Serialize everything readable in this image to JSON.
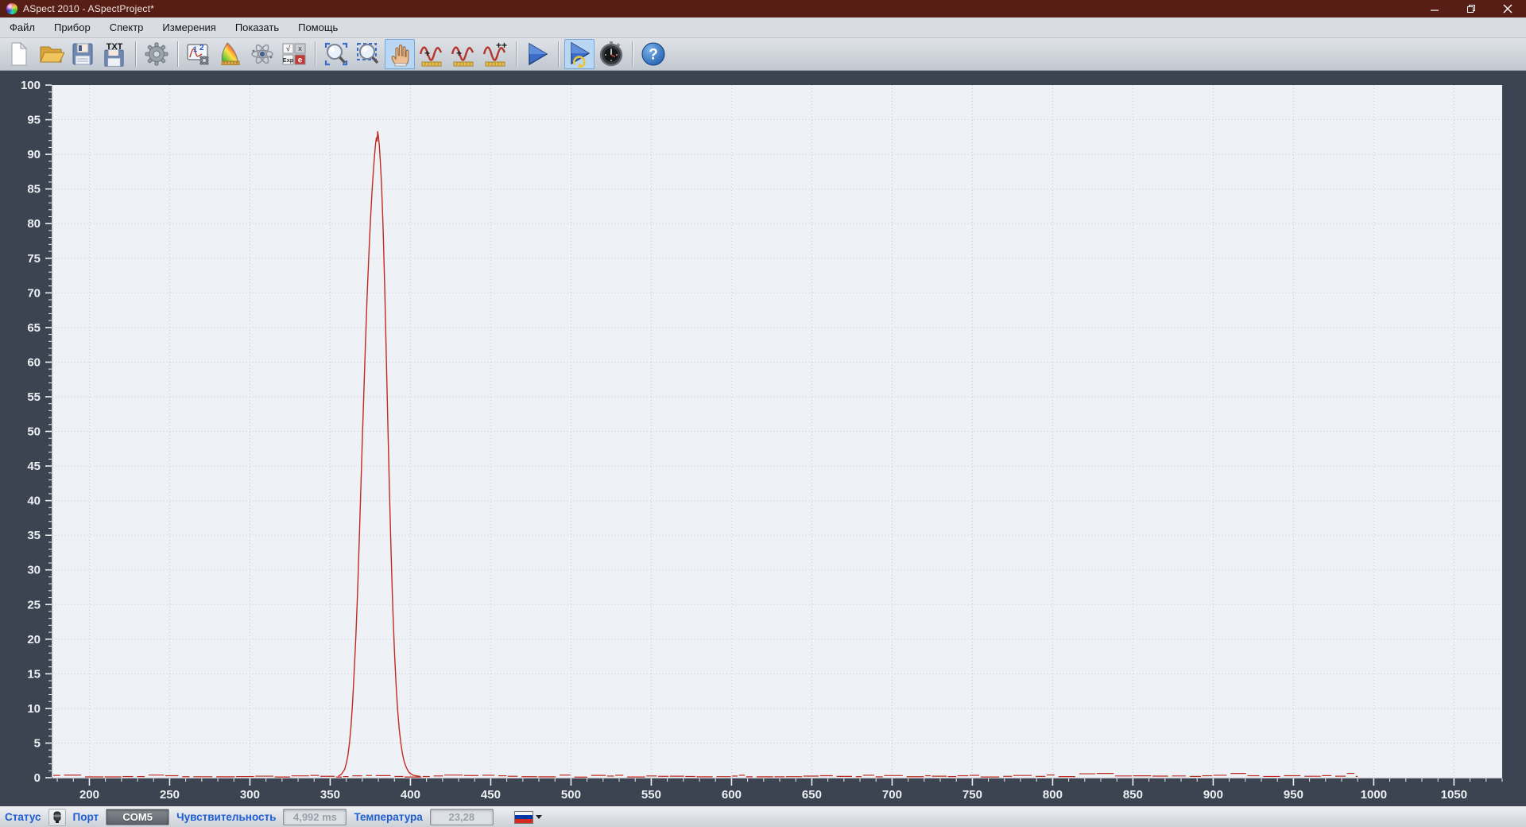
{
  "window": {
    "title": "ASpect 2010 - ASpectProject*",
    "controls": [
      "minimize",
      "restore",
      "close"
    ]
  },
  "menu": {
    "items": [
      "Файл",
      "Прибор",
      "Спектр",
      "Измерения",
      "Показать",
      "Помощь"
    ]
  },
  "toolbar": {
    "groups": [
      {
        "buttons": [
          {
            "name": "new-document",
            "icon": "new-document-icon"
          },
          {
            "name": "open-project",
            "icon": "open-folder-icon"
          },
          {
            "name": "save-project",
            "icon": "save-icon"
          },
          {
            "name": "export-txt",
            "icon": "save-txt-icon",
            "glyph": "TXT"
          }
        ]
      },
      {
        "buttons": [
          {
            "name": "settings",
            "icon": "gear-icon"
          }
        ]
      },
      {
        "buttons": [
          {
            "name": "measurement-setup",
            "icon": "measurement-setup-icon",
            "glyph": "1 2"
          },
          {
            "name": "color-measurement",
            "icon": "color-triangle-icon"
          },
          {
            "name": "atomic-spectra",
            "icon": "atom-icon"
          },
          {
            "name": "math-functions",
            "icon": "math-icon",
            "glyphs": [
              "√",
              "x",
              "Exp",
              "e"
            ]
          }
        ]
      },
      {
        "buttons": [
          {
            "name": "zoom-in",
            "icon": "zoom-in-icon"
          },
          {
            "name": "zoom-out",
            "icon": "zoom-out-icon"
          },
          {
            "name": "pan",
            "icon": "hand-icon",
            "active": true
          },
          {
            "name": "peak-tool-1",
            "icon": "wave-plus-icon",
            "glyph": "+"
          },
          {
            "name": "peak-tool-2",
            "icon": "wave-plus-icon",
            "glyph": "+"
          },
          {
            "name": "peak-tool-3",
            "icon": "wave-plus-icon",
            "glyph": "++"
          }
        ]
      },
      {
        "buttons": [
          {
            "name": "start-measurement",
            "icon": "play-icon"
          }
        ]
      },
      {
        "buttons": [
          {
            "name": "continuous-measurement",
            "icon": "play-repeat-icon",
            "active": true
          },
          {
            "name": "timer",
            "icon": "stopwatch-icon"
          }
        ]
      },
      {
        "buttons": [
          {
            "name": "help",
            "icon": "help-icon",
            "glyph": "?"
          }
        ]
      }
    ]
  },
  "chart_data": {
    "type": "line",
    "title": "",
    "xlabel": "",
    "ylabel": "",
    "grid": "dotted",
    "legend": "none",
    "x_axis": {
      "min": 177,
      "max": 1080,
      "label_min": 200,
      "label_max": 1050,
      "major_step": 50,
      "minor_step": 10
    },
    "y_axis": {
      "min": 0,
      "max": 100,
      "major_step": 5,
      "minor_step": 1
    },
    "series": [
      {
        "name": "emission-spectrum",
        "color": "#bf2b20",
        "peak": {
          "center_nm": 379.5,
          "max_value": 93.3,
          "base_from_nm": 359,
          "base_to_nm": 404
        },
        "points": [
          [
            355,
            0.2
          ],
          [
            357,
            0.5
          ],
          [
            359,
            1.2
          ],
          [
            360,
            2
          ],
          [
            361,
            3.2
          ],
          [
            362,
            5
          ],
          [
            363,
            7.5
          ],
          [
            364,
            11
          ],
          [
            365,
            15.5
          ],
          [
            366,
            20.5
          ],
          [
            367,
            26.5
          ],
          [
            368,
            33.5
          ],
          [
            369,
            41
          ],
          [
            370,
            48.5
          ],
          [
            371,
            56
          ],
          [
            372,
            63
          ],
          [
            373,
            69.5
          ],
          [
            374,
            75
          ],
          [
            375,
            80
          ],
          [
            376,
            84.5
          ],
          [
            377,
            88
          ],
          [
            377.8,
            90.3
          ],
          [
            378.3,
            91.6
          ],
          [
            378.8,
            92.4
          ],
          [
            379.2,
            91.9
          ],
          [
            379.6,
            93.3
          ],
          [
            380.1,
            92.5
          ],
          [
            380.6,
            91.2
          ],
          [
            381.2,
            89
          ],
          [
            382,
            85.5
          ],
          [
            383,
            79
          ],
          [
            384,
            70.5
          ],
          [
            385,
            60.5
          ],
          [
            386,
            50
          ],
          [
            387,
            40.5
          ],
          [
            388,
            32
          ],
          [
            389,
            24.5
          ],
          [
            390,
            18.5
          ],
          [
            391,
            13.5
          ],
          [
            392,
            9.8
          ],
          [
            393,
            7
          ],
          [
            394,
            5
          ],
          [
            395,
            3.5
          ],
          [
            396,
            2.4
          ],
          [
            397,
            1.7
          ],
          [
            398,
            1.2
          ],
          [
            399,
            0.8
          ],
          [
            400,
            0.6
          ],
          [
            401,
            0.45
          ],
          [
            402,
            0.35
          ],
          [
            404,
            0.25
          ],
          [
            406,
            0.2
          ]
        ],
        "baseline": {
          "from_nm": 177,
          "to_nm": 990,
          "level": 0.2,
          "appearance": "noisy dashed near zero"
        }
      }
    ]
  },
  "statusbar": {
    "status_label": "Статус",
    "port_label": "Порт",
    "port_value": "COM5",
    "sensitivity_label": "Чувствительность",
    "sensitivity_value": "4,992 ms",
    "temperature_label": "Температура",
    "temperature_value": "23,28",
    "language_flag": "russia-flag"
  },
  "colors": {
    "titlebar": "#571e16",
    "chart_frame": "#3b4450",
    "plot_bg": "#eef1f6",
    "grid": "#c6cbd4",
    "data_red": "#bf2b20",
    "active_button_bg": "#b9d6f2",
    "status_text": "#1e5ed2"
  }
}
